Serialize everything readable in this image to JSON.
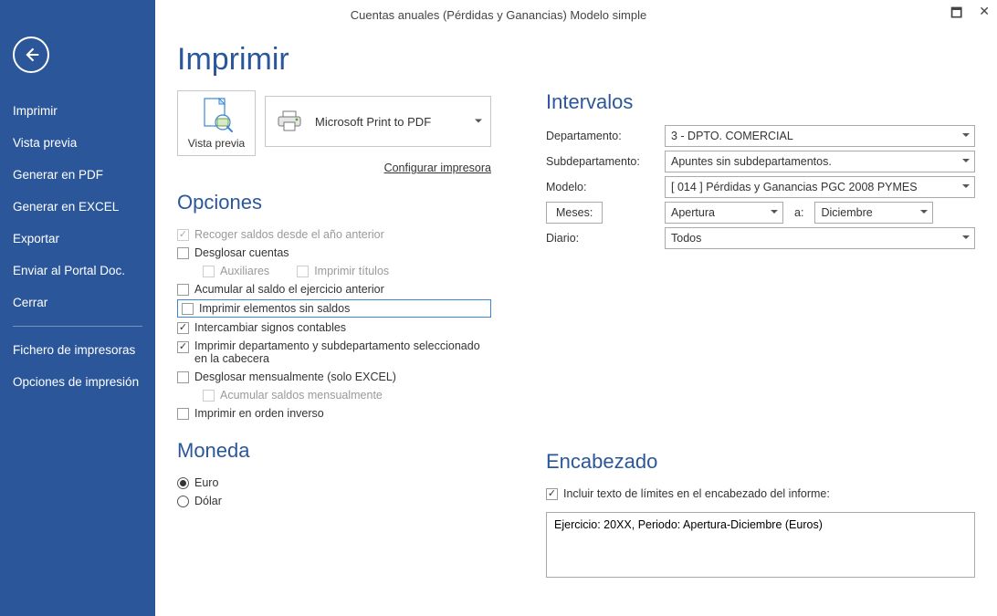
{
  "window": {
    "title": "Cuentas anuales (Pérdidas y Ganancias) Modelo simple"
  },
  "sidebar": {
    "items": [
      {
        "label": "Imprimir"
      },
      {
        "label": "Vista previa"
      },
      {
        "label": "Generar en PDF"
      },
      {
        "label": "Generar en EXCEL"
      },
      {
        "label": "Exportar"
      },
      {
        "label": "Enviar al Portal Doc."
      },
      {
        "label": "Cerrar"
      }
    ],
    "footer_items": [
      {
        "label": "Fichero de impresoras"
      },
      {
        "label": "Opciones de impresión"
      }
    ]
  },
  "page": {
    "title": "Imprimir",
    "preview_button": "Vista previa",
    "printer_selected": "Microsoft Print to PDF",
    "configure_printer": "Configurar impresora",
    "sections": {
      "opciones": "Opciones",
      "moneda": "Moneda",
      "intervalos": "Intervalos",
      "encabezado": "Encabezado"
    }
  },
  "options": {
    "recoger_saldos": "Recoger saldos desde el año anterior",
    "desglosar_cuentas": "Desglosar cuentas",
    "auxiliares": "Auxiliares",
    "imprimir_titulos": "Imprimir títulos",
    "acumular_saldo": "Acumular al saldo el ejercicio anterior",
    "imprimir_sin_saldos": "Imprimir elementos sin saldos",
    "intercambiar_signos": "Intercambiar signos contables",
    "imprimir_dpto_cab": "Imprimir departamento y subdepartamento seleccionado en la cabecera",
    "desglosar_mensual": "Desglosar mensualmente (solo EXCEL)",
    "acumular_mensual": "Acumular saldos mensualmente",
    "orden_inverso": "Imprimir en orden inverso"
  },
  "currency": {
    "euro": "Euro",
    "dolar": "Dólar"
  },
  "intervals": {
    "labels": {
      "departamento": "Departamento:",
      "subdepartamento": "Subdepartamento:",
      "modelo": "Modelo:",
      "meses": "Meses:",
      "a": "a:",
      "diario": "Diario:"
    },
    "departamento": "3 - DPTO. COMERCIAL",
    "subdepartamento": "Apuntes sin subdepartamentos.",
    "modelo": "[ 014 ] Pérdidas y Ganancias PGC 2008 PYMES",
    "mes_desde": "Apertura",
    "mes_hasta": "Diciembre",
    "diario": "Todos"
  },
  "header": {
    "incluir_limites": "Incluir texto de límites en el encabezado del informe:",
    "text": "Ejercicio: 20XX, Periodo: Apertura-Diciembre (Euros)"
  }
}
